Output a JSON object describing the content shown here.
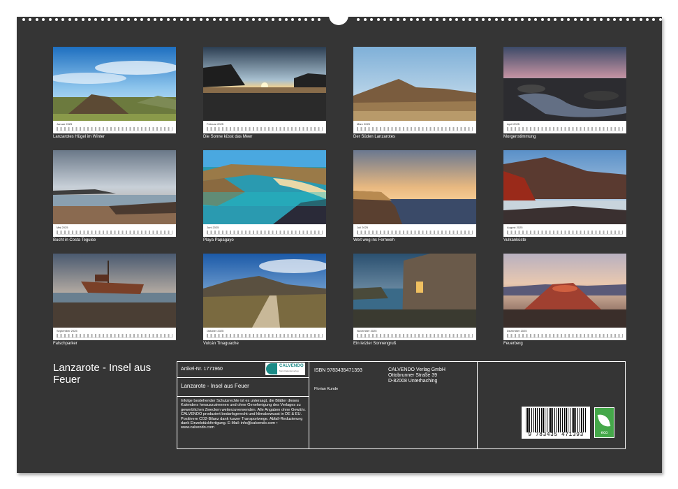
{
  "months": [
    {
      "label": "Januar 2025",
      "caption": "Lanzarotes Hügel im Winter"
    },
    {
      "label": "Februar 2025",
      "caption": "Die Sonne küsst das Meer"
    },
    {
      "label": "März 2025",
      "caption": "Der Süden Lanzarotes"
    },
    {
      "label": "April 2025",
      "caption": "Morgenstimmung"
    },
    {
      "label": "Mai 2025",
      "caption": "Bucht in Costa Teguise"
    },
    {
      "label": "Juni 2025",
      "caption": "Playa Papagayo"
    },
    {
      "label": "Juli 2025",
      "caption": "Weit weg ins Fernweh"
    },
    {
      "label": "August 2025",
      "caption": "Vulkanküste"
    },
    {
      "label": "September 2025",
      "caption": "Falschparker"
    },
    {
      "label": "Oktober 2025",
      "caption": "Vulcán Tinaguache"
    },
    {
      "label": "November 2025",
      "caption": "Ein letzter Sonnengruß"
    },
    {
      "label": "Dezember 2025",
      "caption": "Feuerberg"
    }
  ],
  "cover_title": "Lanzarote - Insel aus Feuer",
  "info": {
    "artikel": "Artikel-Nr. 1771960",
    "title_repeat": "Lanzarote - Insel aus Feuer",
    "legal": "Infolge bestehender Schutzrechte ist es untersagt, die Blätter dieses Kalenders herauszutrennen und ohne Genehmigung des Verlages zu gewerblichen Zwecken weiterzuverwenden. Alle Angaben ohne Gewähr. CALVENDO produziert bedarfsgerecht und klimabewusst in DE & EU. Positivere CO2-Bilanz dank kurzer Transportwege. Abfall-Reduzierung dank Einzelstückfertigung. E-Mail: info@calvendo.com • www.calvendo.com",
    "isbn": "ISBN 9783435471393",
    "author": "Florian Kunde",
    "publisher_line1": "CALVENDO Verlag GmbH",
    "publisher_line2": "Ottobrunner Straße 39",
    "publisher_line3": "D-82008 Unterhaching",
    "barcode_digits": "9 783435 471393",
    "logo_text": "CALVENDO",
    "logo_sub": "Mein Kalenderverlag",
    "eco_label": "eco"
  },
  "colors": {
    "board": "#353535",
    "eco_green": "#45a84a",
    "calvendo_teal": "#1a8a86"
  }
}
